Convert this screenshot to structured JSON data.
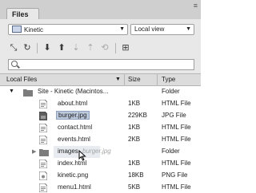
{
  "panel": {
    "tab_label": "Files",
    "menu_glyph": "≡"
  },
  "site_select": {
    "value": "Kinetic"
  },
  "view_select": {
    "value": "Local view"
  },
  "toolbar": {
    "buttons": [
      {
        "name": "connect-icon",
        "glyph": "⤡"
      },
      {
        "name": "refresh-icon",
        "glyph": "↻"
      },
      {
        "name": "get-files-icon",
        "glyph": "⬇"
      },
      {
        "name": "put-files-icon",
        "glyph": "⬆"
      },
      {
        "name": "check-out-icon",
        "glyph": "⇣"
      },
      {
        "name": "check-in-icon",
        "glyph": "⇡"
      },
      {
        "name": "sync-icon",
        "glyph": "⟲"
      },
      {
        "name": "expand-icon",
        "glyph": "⊞"
      }
    ]
  },
  "search": {
    "placeholder": ""
  },
  "columns": {
    "name": "Local Files",
    "size": "Size",
    "type": "Type"
  },
  "rows": [
    {
      "name": "Site - Kinetic (Macintos...",
      "size": "",
      "type": "Folder",
      "icon": "site-folder-icon"
    },
    {
      "name": "about.html",
      "size": "1KB",
      "type": "HTML File",
      "icon": "html-file-icon"
    },
    {
      "name": "burger.jpg",
      "size": "229KB",
      "type": "JPG File",
      "icon": "image-file-icon"
    },
    {
      "name": "contact.html",
      "size": "1KB",
      "type": "HTML File",
      "icon": "html-file-icon"
    },
    {
      "name": "events.html",
      "size": "2KB",
      "type": "HTML File",
      "icon": "html-file-icon"
    },
    {
      "name": "images",
      "size": "",
      "type": "Folder",
      "icon": "folder-icon"
    },
    {
      "name": "index.html",
      "size": "1KB",
      "type": "HTML File",
      "icon": "html-file-icon"
    },
    {
      "name": "kinetic.png",
      "size": "18KB",
      "type": "PNG File",
      "icon": "image-file-icon"
    },
    {
      "name": "menu1.html",
      "size": "5KB",
      "type": "HTML File",
      "icon": "html-file-icon"
    }
  ],
  "drag_ghost": "burger.jpg",
  "colors": {
    "selection": "#bdc9dd",
    "panel_bg": "#e8e8e8"
  }
}
